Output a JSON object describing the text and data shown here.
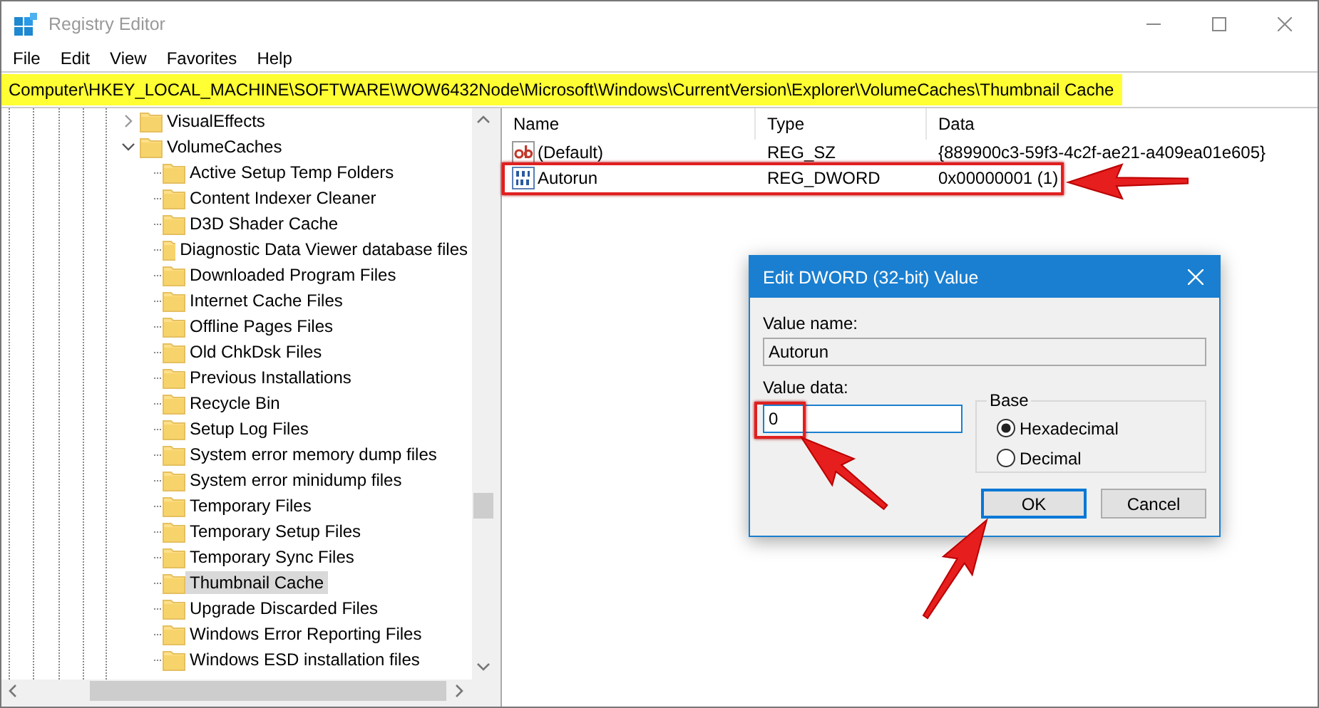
{
  "window": {
    "title": "Registry Editor"
  },
  "menu": [
    "File",
    "Edit",
    "View",
    "Favorites",
    "Help"
  ],
  "address": {
    "value": "Computer\\HKEY_LOCAL_MACHINE\\SOFTWARE\\WOW6432Node\\Microsoft\\Windows\\CurrentVersion\\Explorer\\VolumeCaches\\Thumbnail Cache",
    "highlighted": true
  },
  "tree": {
    "items": [
      {
        "label": "VisualEffects",
        "expanded": false,
        "selected": false
      },
      {
        "label": "VolumeCaches",
        "expanded": true,
        "selected": false,
        "children": [
          {
            "label": "Active Setup Temp Folders",
            "selected": false
          },
          {
            "label": "Content Indexer Cleaner",
            "selected": false
          },
          {
            "label": "D3D Shader Cache",
            "selected": false
          },
          {
            "label": "Diagnostic Data Viewer database files",
            "selected": false
          },
          {
            "label": "Downloaded Program Files",
            "selected": false
          },
          {
            "label": "Internet Cache Files",
            "selected": false
          },
          {
            "label": "Offline Pages Files",
            "selected": false
          },
          {
            "label": "Old ChkDsk Files",
            "selected": false
          },
          {
            "label": "Previous Installations",
            "selected": false
          },
          {
            "label": "Recycle Bin",
            "selected": false
          },
          {
            "label": "Setup Log Files",
            "selected": false
          },
          {
            "label": "System error memory dump files",
            "selected": false
          },
          {
            "label": "System error minidump files",
            "selected": false
          },
          {
            "label": "Temporary Files",
            "selected": false
          },
          {
            "label": "Temporary Setup Files",
            "selected": false
          },
          {
            "label": "Temporary Sync Files",
            "selected": false
          },
          {
            "label": "Thumbnail Cache",
            "selected": true
          },
          {
            "label": "Upgrade Discarded Files",
            "selected": false
          },
          {
            "label": "Windows Error Reporting Files",
            "selected": false
          },
          {
            "label": "Windows ESD installation files",
            "selected": false
          }
        ]
      }
    ]
  },
  "values": {
    "columns": [
      "Name",
      "Type",
      "Data"
    ],
    "rows": [
      {
        "kind": "string",
        "name": "(Default)",
        "type": "REG_SZ",
        "data": "{889900c3-59f3-4c2f-ae21-a409ea01e605}",
        "marked": false
      },
      {
        "kind": "binary",
        "name": "Autorun",
        "type": "REG_DWORD",
        "data": "0x00000001 (1)",
        "marked": true
      }
    ]
  },
  "dialog": {
    "title": "Edit DWORD (32-bit) Value",
    "value_name_label": "Value name:",
    "value_name": "Autorun",
    "value_data_label": "Value data:",
    "value_data": "0",
    "value_data_marked": true,
    "base_label": "Base",
    "bases": [
      {
        "label": "Hexadecimal",
        "selected": true
      },
      {
        "label": "Decimal",
        "selected": false
      }
    ],
    "buttons": [
      {
        "label": "OK",
        "default": true
      },
      {
        "label": "Cancel",
        "default": false
      }
    ]
  }
}
